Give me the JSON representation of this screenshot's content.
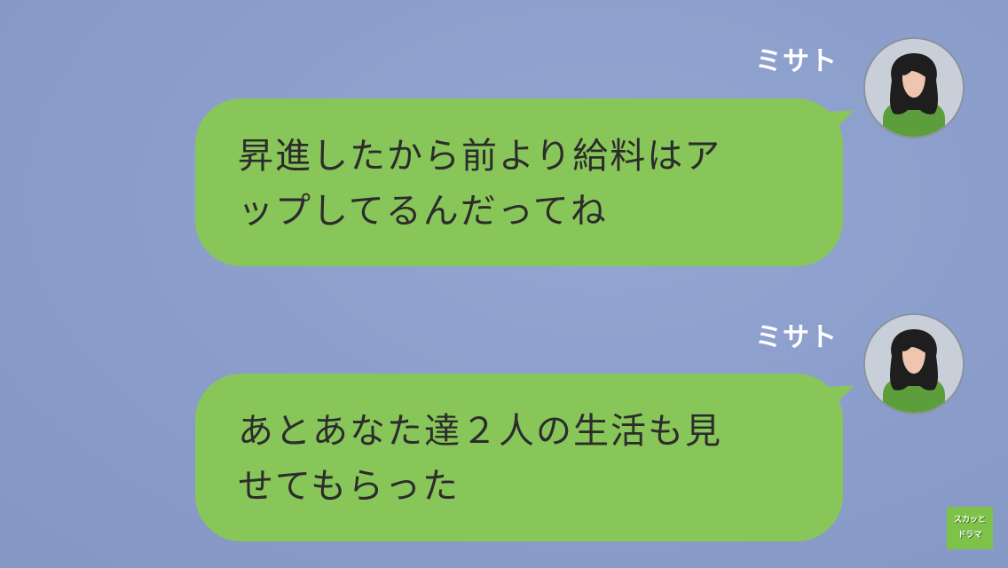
{
  "messages": [
    {
      "sender": "ミサト",
      "lines": [
        "昇進したから前より給料はア",
        "ップしてるんだってね"
      ]
    },
    {
      "sender": "ミサト",
      "lines": [
        "あとあなた達２人の生活も見",
        "せてもらった"
      ]
    }
  ],
  "avatar_icon": "woman-avatar-icon",
  "watermark": {
    "line1": "スカッと",
    "line2": "ドラマ"
  },
  "colors": {
    "background": "#8c9ecb",
    "bubble": "#89c65a",
    "sender_text": "#ffffff",
    "message_text": "#2c2c2c",
    "avatar_shirt": "#5d9e3c",
    "avatar_hair": "#1e1e1e"
  }
}
